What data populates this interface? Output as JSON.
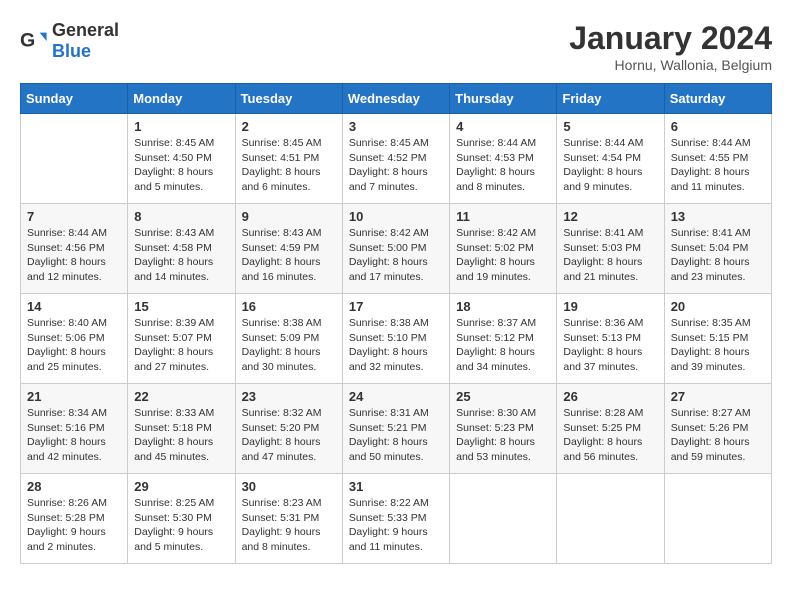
{
  "header": {
    "logo_general": "General",
    "logo_blue": "Blue",
    "month_title": "January 2024",
    "location": "Hornu, Wallonia, Belgium"
  },
  "days_of_week": [
    "Sunday",
    "Monday",
    "Tuesday",
    "Wednesday",
    "Thursday",
    "Friday",
    "Saturday"
  ],
  "weeks": [
    [
      {
        "day": "",
        "sunrise": "",
        "sunset": "",
        "daylight": ""
      },
      {
        "day": "1",
        "sunrise": "Sunrise: 8:45 AM",
        "sunset": "Sunset: 4:50 PM",
        "daylight": "Daylight: 8 hours and 5 minutes."
      },
      {
        "day": "2",
        "sunrise": "Sunrise: 8:45 AM",
        "sunset": "Sunset: 4:51 PM",
        "daylight": "Daylight: 8 hours and 6 minutes."
      },
      {
        "day": "3",
        "sunrise": "Sunrise: 8:45 AM",
        "sunset": "Sunset: 4:52 PM",
        "daylight": "Daylight: 8 hours and 7 minutes."
      },
      {
        "day": "4",
        "sunrise": "Sunrise: 8:44 AM",
        "sunset": "Sunset: 4:53 PM",
        "daylight": "Daylight: 8 hours and 8 minutes."
      },
      {
        "day": "5",
        "sunrise": "Sunrise: 8:44 AM",
        "sunset": "Sunset: 4:54 PM",
        "daylight": "Daylight: 8 hours and 9 minutes."
      },
      {
        "day": "6",
        "sunrise": "Sunrise: 8:44 AM",
        "sunset": "Sunset: 4:55 PM",
        "daylight": "Daylight: 8 hours and 11 minutes."
      }
    ],
    [
      {
        "day": "7",
        "sunrise": "Sunrise: 8:44 AM",
        "sunset": "Sunset: 4:56 PM",
        "daylight": "Daylight: 8 hours and 12 minutes."
      },
      {
        "day": "8",
        "sunrise": "Sunrise: 8:43 AM",
        "sunset": "Sunset: 4:58 PM",
        "daylight": "Daylight: 8 hours and 14 minutes."
      },
      {
        "day": "9",
        "sunrise": "Sunrise: 8:43 AM",
        "sunset": "Sunset: 4:59 PM",
        "daylight": "Daylight: 8 hours and 16 minutes."
      },
      {
        "day": "10",
        "sunrise": "Sunrise: 8:42 AM",
        "sunset": "Sunset: 5:00 PM",
        "daylight": "Daylight: 8 hours and 17 minutes."
      },
      {
        "day": "11",
        "sunrise": "Sunrise: 8:42 AM",
        "sunset": "Sunset: 5:02 PM",
        "daylight": "Daylight: 8 hours and 19 minutes."
      },
      {
        "day": "12",
        "sunrise": "Sunrise: 8:41 AM",
        "sunset": "Sunset: 5:03 PM",
        "daylight": "Daylight: 8 hours and 21 minutes."
      },
      {
        "day": "13",
        "sunrise": "Sunrise: 8:41 AM",
        "sunset": "Sunset: 5:04 PM",
        "daylight": "Daylight: 8 hours and 23 minutes."
      }
    ],
    [
      {
        "day": "14",
        "sunrise": "Sunrise: 8:40 AM",
        "sunset": "Sunset: 5:06 PM",
        "daylight": "Daylight: 8 hours and 25 minutes."
      },
      {
        "day": "15",
        "sunrise": "Sunrise: 8:39 AM",
        "sunset": "Sunset: 5:07 PM",
        "daylight": "Daylight: 8 hours and 27 minutes."
      },
      {
        "day": "16",
        "sunrise": "Sunrise: 8:38 AM",
        "sunset": "Sunset: 5:09 PM",
        "daylight": "Daylight: 8 hours and 30 minutes."
      },
      {
        "day": "17",
        "sunrise": "Sunrise: 8:38 AM",
        "sunset": "Sunset: 5:10 PM",
        "daylight": "Daylight: 8 hours and 32 minutes."
      },
      {
        "day": "18",
        "sunrise": "Sunrise: 8:37 AM",
        "sunset": "Sunset: 5:12 PM",
        "daylight": "Daylight: 8 hours and 34 minutes."
      },
      {
        "day": "19",
        "sunrise": "Sunrise: 8:36 AM",
        "sunset": "Sunset: 5:13 PM",
        "daylight": "Daylight: 8 hours and 37 minutes."
      },
      {
        "day": "20",
        "sunrise": "Sunrise: 8:35 AM",
        "sunset": "Sunset: 5:15 PM",
        "daylight": "Daylight: 8 hours and 39 minutes."
      }
    ],
    [
      {
        "day": "21",
        "sunrise": "Sunrise: 8:34 AM",
        "sunset": "Sunset: 5:16 PM",
        "daylight": "Daylight: 8 hours and 42 minutes."
      },
      {
        "day": "22",
        "sunrise": "Sunrise: 8:33 AM",
        "sunset": "Sunset: 5:18 PM",
        "daylight": "Daylight: 8 hours and 45 minutes."
      },
      {
        "day": "23",
        "sunrise": "Sunrise: 8:32 AM",
        "sunset": "Sunset: 5:20 PM",
        "daylight": "Daylight: 8 hours and 47 minutes."
      },
      {
        "day": "24",
        "sunrise": "Sunrise: 8:31 AM",
        "sunset": "Sunset: 5:21 PM",
        "daylight": "Daylight: 8 hours and 50 minutes."
      },
      {
        "day": "25",
        "sunrise": "Sunrise: 8:30 AM",
        "sunset": "Sunset: 5:23 PM",
        "daylight": "Daylight: 8 hours and 53 minutes."
      },
      {
        "day": "26",
        "sunrise": "Sunrise: 8:28 AM",
        "sunset": "Sunset: 5:25 PM",
        "daylight": "Daylight: 8 hours and 56 minutes."
      },
      {
        "day": "27",
        "sunrise": "Sunrise: 8:27 AM",
        "sunset": "Sunset: 5:26 PM",
        "daylight": "Daylight: 8 hours and 59 minutes."
      }
    ],
    [
      {
        "day": "28",
        "sunrise": "Sunrise: 8:26 AM",
        "sunset": "Sunset: 5:28 PM",
        "daylight": "Daylight: 9 hours and 2 minutes."
      },
      {
        "day": "29",
        "sunrise": "Sunrise: 8:25 AM",
        "sunset": "Sunset: 5:30 PM",
        "daylight": "Daylight: 9 hours and 5 minutes."
      },
      {
        "day": "30",
        "sunrise": "Sunrise: 8:23 AM",
        "sunset": "Sunset: 5:31 PM",
        "daylight": "Daylight: 9 hours and 8 minutes."
      },
      {
        "day": "31",
        "sunrise": "Sunrise: 8:22 AM",
        "sunset": "Sunset: 5:33 PM",
        "daylight": "Daylight: 9 hours and 11 minutes."
      },
      {
        "day": "",
        "sunrise": "",
        "sunset": "",
        "daylight": ""
      },
      {
        "day": "",
        "sunrise": "",
        "sunset": "",
        "daylight": ""
      },
      {
        "day": "",
        "sunrise": "",
        "sunset": "",
        "daylight": ""
      }
    ]
  ]
}
